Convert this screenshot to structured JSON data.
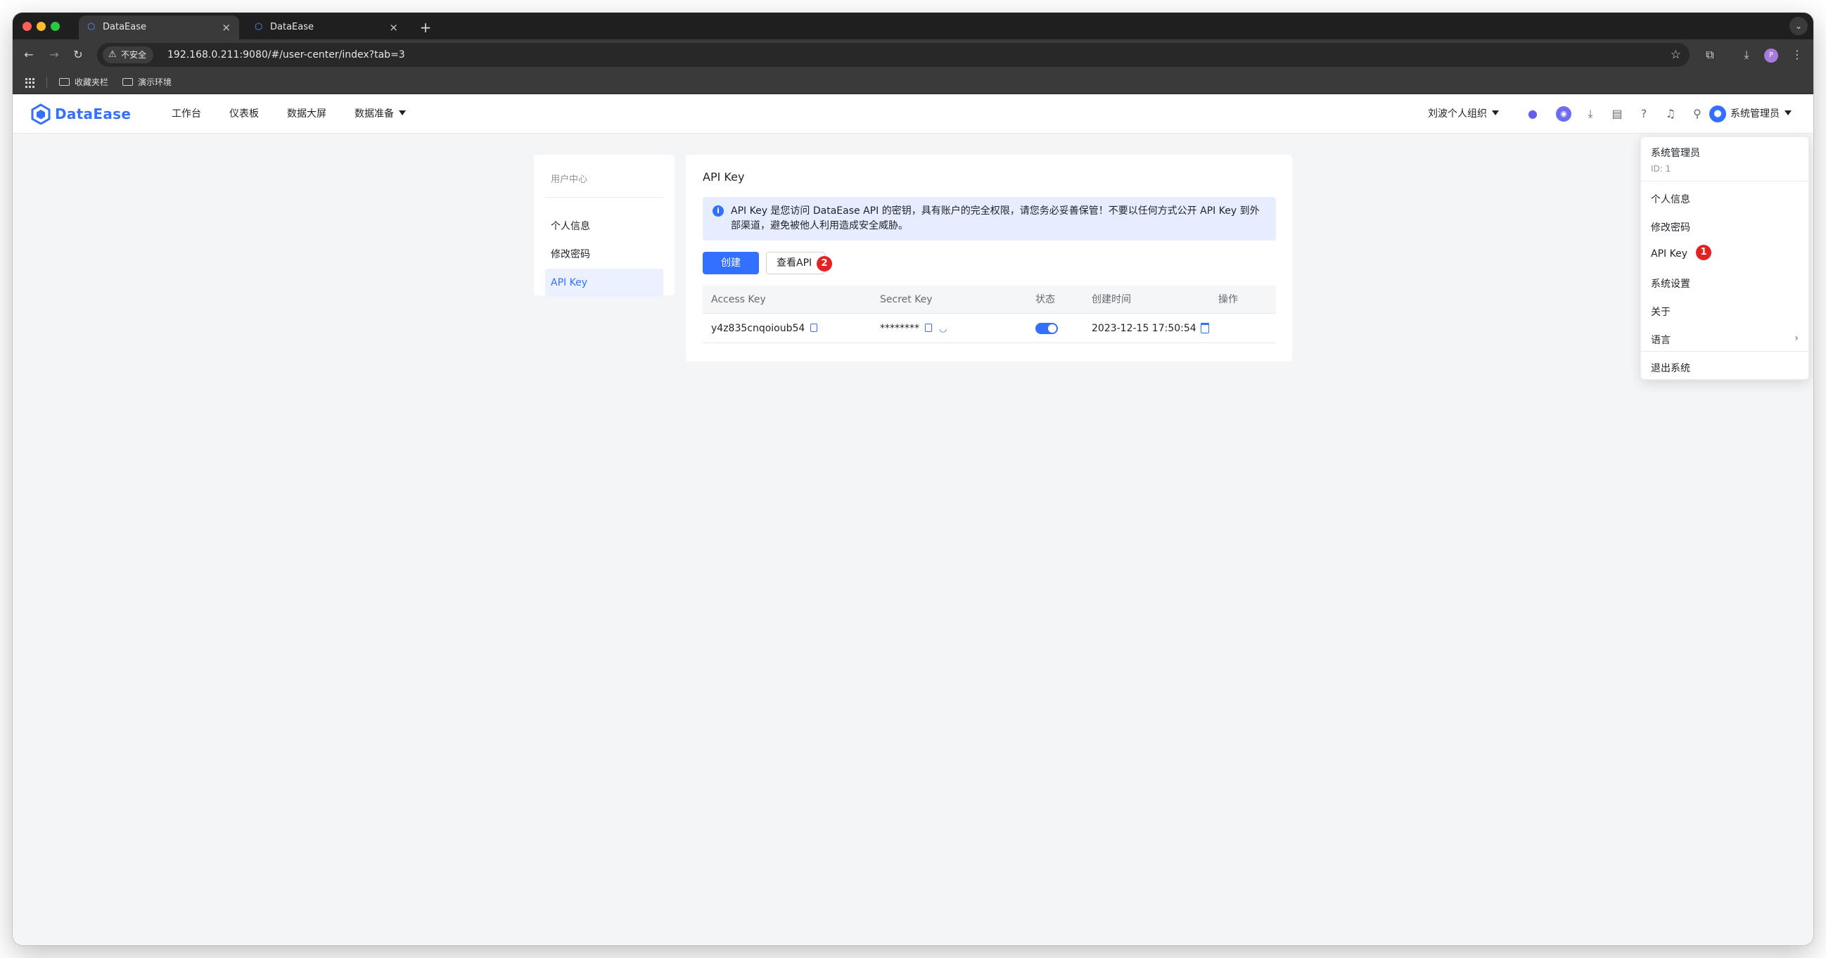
{
  "browser": {
    "tabs": [
      {
        "title": "DataEase",
        "active": true
      },
      {
        "title": "DataEase",
        "active": false
      }
    ],
    "security_label": "不安全",
    "url": "192.168.0.211:9080/#/user-center/index?tab=3",
    "bookmarks": [
      "收藏夹栏",
      "演示环境"
    ],
    "profile_initial": "P"
  },
  "app": {
    "brand": "DataEase",
    "nav": [
      "工作台",
      "仪表板",
      "数据大屏",
      "数据准备"
    ],
    "org": "刘波个人组织",
    "user": "系统管理员",
    "accent": "#3370ff"
  },
  "sidebar": {
    "heading": "用户中心",
    "items": [
      {
        "label": "个人信息",
        "active": false
      },
      {
        "label": "修改密码",
        "active": false
      },
      {
        "label": "API Key",
        "active": true
      }
    ]
  },
  "main": {
    "title": "API Key",
    "notice": "API Key 是您访问 DataEase API 的密钥，具有账户的完全权限，请您务必妥善保管！不要以任何方式公开 API Key 到外部渠道，避免被他人利用造成安全威胁。",
    "create_label": "创建",
    "view_label": "查看API",
    "table": {
      "headers": [
        "Access Key",
        "Secret Key",
        "状态",
        "创建时间",
        "操作"
      ],
      "rows": [
        {
          "access_key": "y4z835cnqoioub54",
          "secret_key": "********",
          "enabled": true,
          "created": "2023-12-15 17:50:54"
        }
      ]
    }
  },
  "dropdown": {
    "name": "系统管理员",
    "id": "ID: 1",
    "items": [
      "个人信息",
      "修改密码",
      "API Key",
      "系统设置",
      "关于",
      "语言"
    ],
    "logout": "退出系统"
  },
  "badges": {
    "first": "1",
    "second": "2"
  }
}
